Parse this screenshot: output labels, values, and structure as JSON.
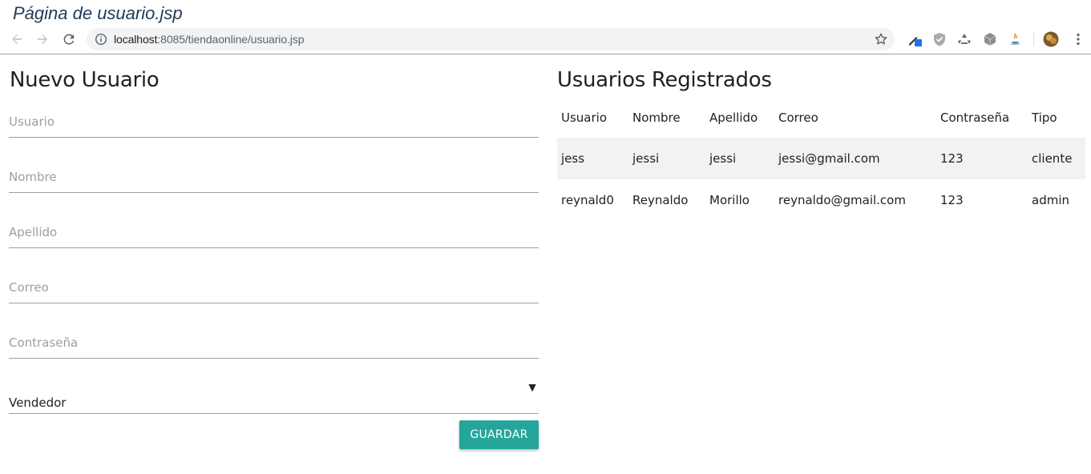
{
  "window": {
    "title": "Página de usuario.jsp"
  },
  "browser": {
    "url_host": "localhost",
    "url_rest": ":8085/tiendaonline/usuario.jsp",
    "icons": [
      "back-arrow-icon",
      "forward-arrow-icon",
      "reload-icon",
      "info-icon",
      "star-icon",
      "eyedropper-extension-icon",
      "shield-extension-icon",
      "recycle-extension-icon",
      "cube-extension-icon",
      "java-extension-icon",
      "profile-avatar",
      "menu-kebab-icon"
    ]
  },
  "form": {
    "heading": "Nuevo Usuario",
    "fields": {
      "usuario": {
        "placeholder": "Usuario",
        "value": ""
      },
      "nombre": {
        "placeholder": "Nombre",
        "value": ""
      },
      "apellido": {
        "placeholder": "Apellido",
        "value": ""
      },
      "correo": {
        "placeholder": "Correo",
        "value": ""
      },
      "contrasena": {
        "placeholder": "Contraseña",
        "value": ""
      }
    },
    "tipo_select": {
      "selected": "Vendedor",
      "caret": "▼"
    },
    "save_label": "GUARDAR",
    "accent_color": "#26a69a"
  },
  "users": {
    "heading": "Usuarios Registrados",
    "columns": [
      "Usuario",
      "Nombre",
      "Apellido",
      "Correo",
      "Contraseña",
      "Tipo"
    ],
    "rows": [
      [
        "jess",
        "jessi",
        "jessi",
        "jessi@gmail.com",
        "123",
        "cliente"
      ],
      [
        "reynald0",
        "Reynaldo",
        "Morillo",
        "reynaldo@gmail.com",
        "123",
        "admin"
      ]
    ]
  }
}
